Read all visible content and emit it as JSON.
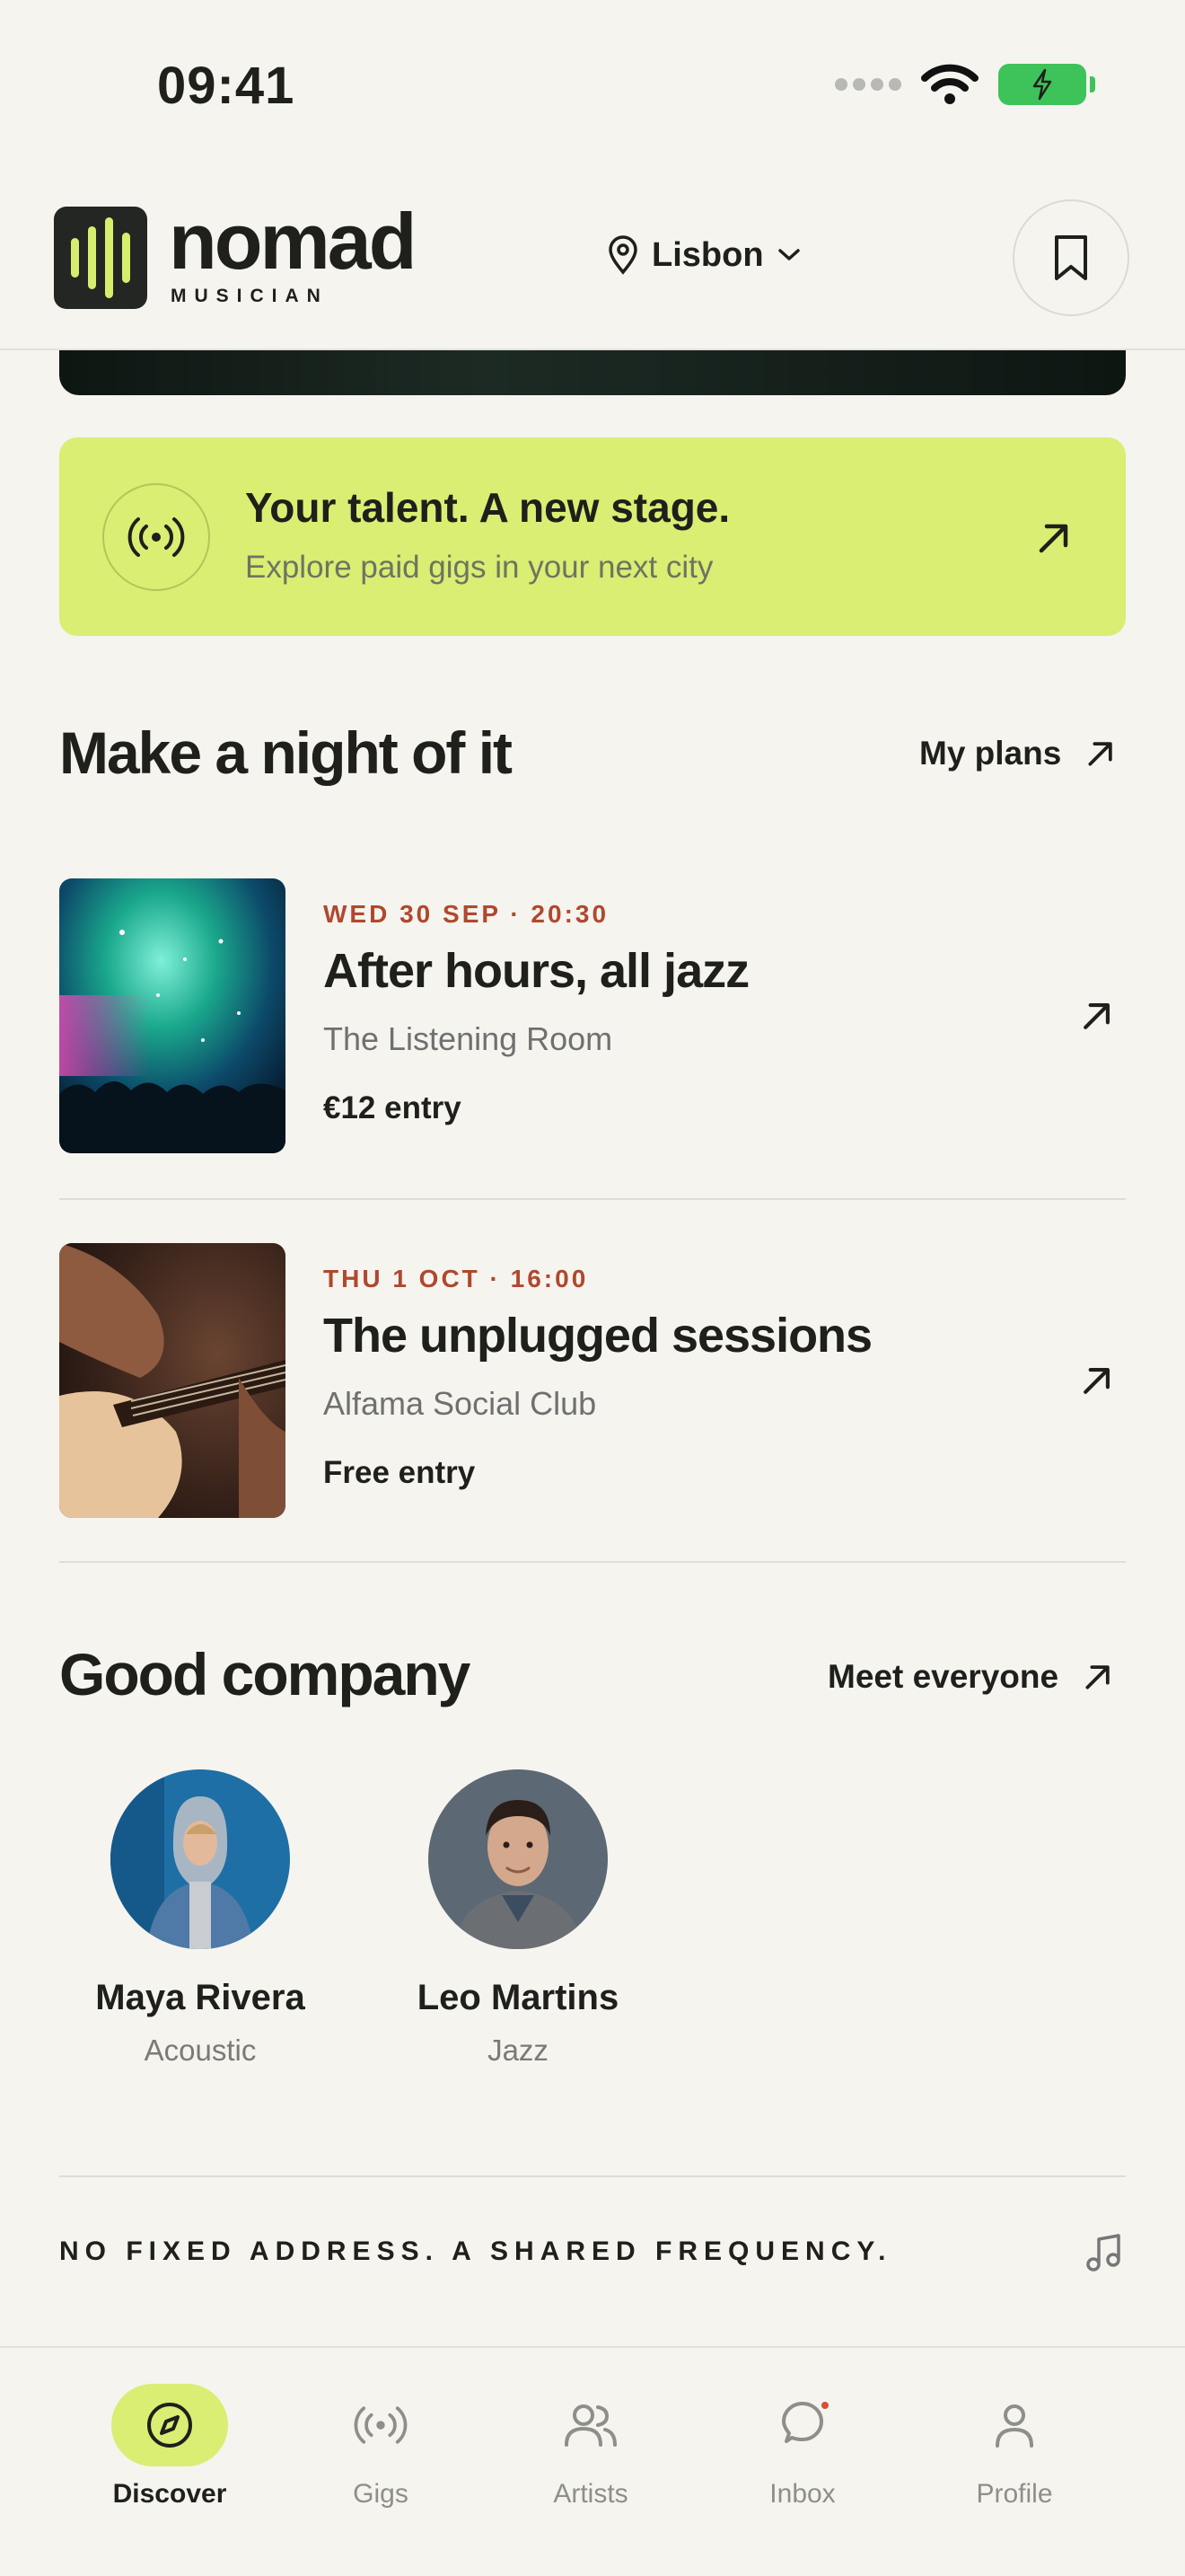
{
  "status_bar": {
    "time": "09:41"
  },
  "header": {
    "brand": "nomad",
    "brand_sub": "MUSICIAN",
    "location": "Lisbon"
  },
  "promo": {
    "title": "Your talent. A new stage.",
    "subtitle": "Explore paid gigs in your next city"
  },
  "plans": {
    "title": "Make a night of it",
    "link": "My plans",
    "events": [
      {
        "date": "WED 30 SEP · 20:30",
        "title": "After hours, all jazz",
        "venue": "The Listening Room",
        "price": "€12 entry"
      },
      {
        "date": "THU 1 OCT · 16:00",
        "title": "The unplugged sessions",
        "venue": "Alfama Social Club",
        "price": "Free entry"
      }
    ]
  },
  "company": {
    "title": "Good company",
    "link": "Meet everyone",
    "artists": [
      {
        "name": "Maya Rivera",
        "genre": "Acoustic"
      },
      {
        "name": "Leo Martins",
        "genre": "Jazz"
      }
    ]
  },
  "tagline": "NO FIXED ADDRESS. A SHARED FREQUENCY.",
  "nav": {
    "items": [
      {
        "label": "Discover",
        "icon": "compass-icon",
        "active": true
      },
      {
        "label": "Gigs",
        "icon": "broadcast-icon"
      },
      {
        "label": "Artists",
        "icon": "users-icon"
      },
      {
        "label": "Inbox",
        "icon": "chat-icon",
        "badge": true
      },
      {
        "label": "Profile",
        "icon": "user-icon"
      }
    ]
  },
  "colors": {
    "accent": "#D9EE73",
    "date": "#B0482E",
    "background": "#F5F4EF"
  }
}
